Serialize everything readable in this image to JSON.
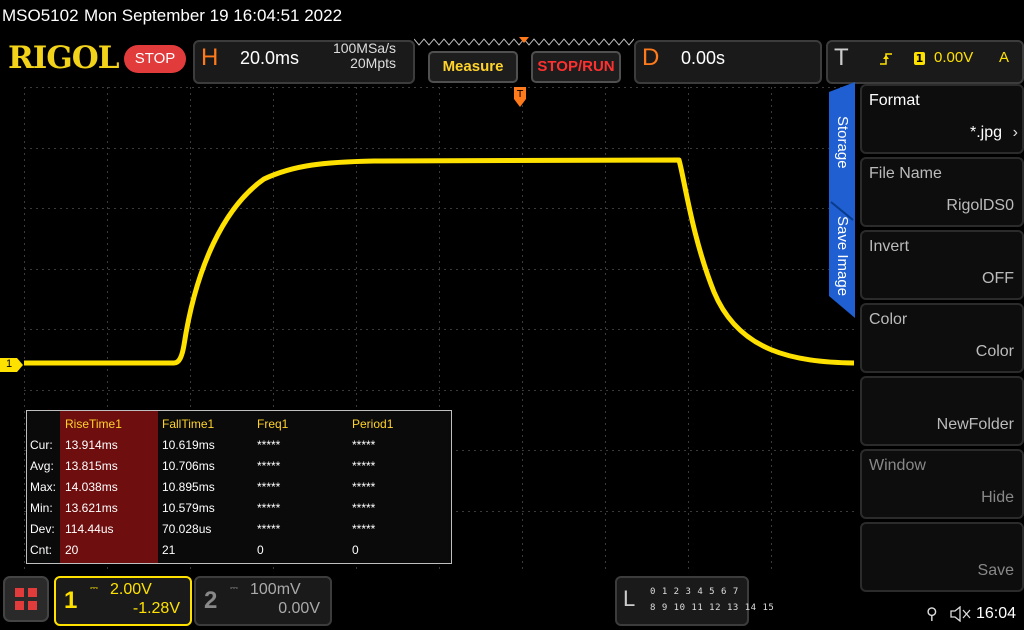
{
  "status_bar": {
    "model": "MSO5102",
    "datetime": "Mon September 19 16:04:51 2022"
  },
  "toolbar": {
    "brand": "RIGOL",
    "run_state": "STOP",
    "horizontal": {
      "letter": "H",
      "timebase": "20.0ms",
      "sample_rate": "100MSa/s",
      "memory_depth": "20Mpts"
    },
    "measure_label": "Measure",
    "stoprun_label": "STOP/RUN",
    "delay": {
      "letter": "D",
      "value": "0.00s"
    },
    "trigger": {
      "letter": "T",
      "channel": "1",
      "level": "0.00V",
      "mode": "A"
    }
  },
  "channel_marker": "1",
  "measurements": {
    "headers": [
      "RiseTime1",
      "FallTime1",
      "Freq1",
      "Period1"
    ],
    "rows": [
      {
        "label": "Cur:",
        "values": [
          "13.914ms",
          "10.619ms",
          "*****",
          "*****"
        ]
      },
      {
        "label": "Avg:",
        "values": [
          "13.815ms",
          "10.706ms",
          "*****",
          "*****"
        ]
      },
      {
        "label": "Max:",
        "values": [
          "14.038ms",
          "10.895ms",
          "*****",
          "*****"
        ]
      },
      {
        "label": "Min:",
        "values": [
          "13.621ms",
          "10.579ms",
          "*****",
          "*****"
        ]
      },
      {
        "label": "Dev:",
        "values": [
          "114.44us",
          "70.028us",
          "*****",
          "*****"
        ]
      },
      {
        "label": "Cnt:",
        "values": [
          "20",
          "21",
          "0",
          "0"
        ]
      }
    ]
  },
  "side_menu": {
    "tabs": [
      "Storage",
      "Save Image"
    ],
    "items": [
      {
        "title": "Format",
        "value": "*.jpg"
      },
      {
        "title": "File Name",
        "value": "RigolDS0"
      },
      {
        "title": "Invert",
        "value": "OFF"
      },
      {
        "title": "Color",
        "value": "Color"
      },
      {
        "title": "",
        "value": "NewFolder"
      },
      {
        "title": "Window",
        "value": "Hide"
      },
      {
        "title": "",
        "value": "Save"
      }
    ]
  },
  "bottom_bar": {
    "ch1": {
      "num": "1",
      "scale": "2.00V",
      "offset": "-1.28V"
    },
    "ch2": {
      "num": "2",
      "scale": "100mV",
      "offset": "0.00V"
    },
    "la": {
      "letter": "L",
      "row1": "0 1 2 3  4 5 6 7",
      "row2": "8 9 10 11 12 13 14 15"
    },
    "clock": "16:04"
  },
  "colors": {
    "trace": "#ffe100",
    "accent_orange": "#ff7a1a",
    "stop_red": "#e23b3b",
    "measure_highlight": "#6e0e0e",
    "panel_blue": "#1f5fd1"
  }
}
